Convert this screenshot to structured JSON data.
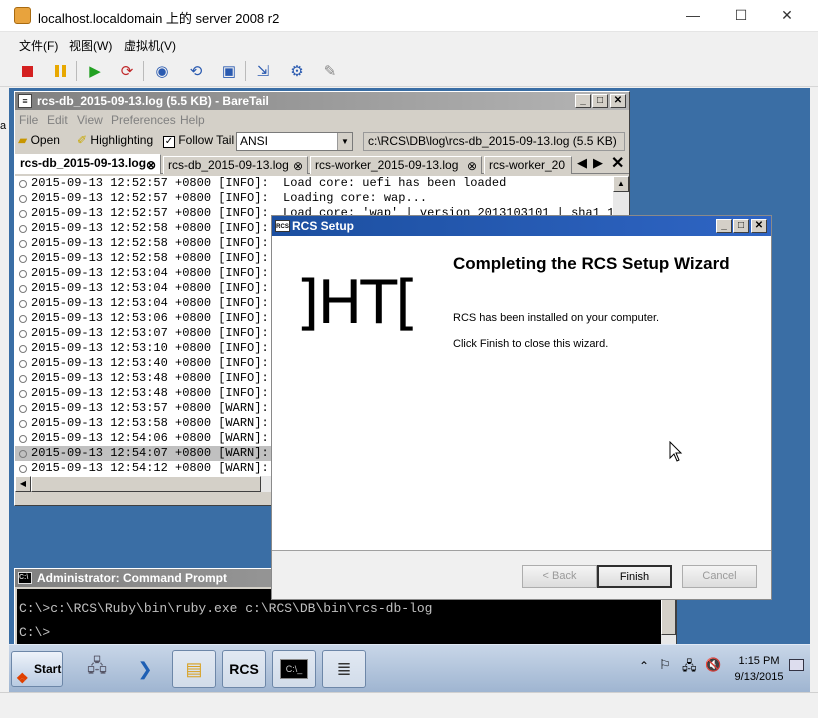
{
  "host": {
    "title": "localhost.localdomain 上的 server 2008 r2",
    "menu": [
      "文件(F)",
      "视图(W)",
      "虚拟机(V)"
    ],
    "controls": {
      "minimize": "—",
      "maximize": "☐",
      "close": "✕"
    }
  },
  "baretail": {
    "title": "rcs-db_2015-09-13.log (5.5 KB) - BareTail",
    "menu": [
      "File",
      "Edit",
      "View",
      "Preferences",
      "Help"
    ],
    "toolbar": {
      "open": "Open",
      "highlighting": "Highlighting",
      "follow_tail": "Follow Tail",
      "follow_tail_checked": "✓",
      "encoding": "ANSI",
      "path": "c:\\RCS\\DB\\log\\rcs-db_2015-09-13.log (5.5 KB)"
    },
    "tabs": [
      "rcs-db_2015-09-13.log",
      "rcs-db_2015-09-13.log",
      "rcs-worker_2015-09-13.log",
      "rcs-worker_20"
    ],
    "tab_close": "⊗",
    "log_lines": [
      "2015-09-13 12:52:57 +0800 [INFO]:  Load core: uefi has been loaded",
      "2015-09-13 12:52:57 +0800 [INFO]:  Loading core: wap...",
      "2015-09-13 12:52:57 +0800 [INFO]:  Load core: 'wap' | version 2013103101 | sha1 102",
      "2015-09-13 12:52:58 +0800 [INFO]:",
      "2015-09-13 12:52:58 +0800 [INFO]:",
      "2015-09-13 12:52:58 +0800 [INFO]:",
      "2015-09-13 12:53:04 +0800 [INFO]:",
      "2015-09-13 12:53:04 +0800 [INFO]:",
      "2015-09-13 12:53:04 +0800 [INFO]:",
      "2015-09-13 12:53:06 +0800 [INFO]:",
      "2015-09-13 12:53:07 +0800 [INFO]:",
      "2015-09-13 12:53:10 +0800 [INFO]:",
      "2015-09-13 12:53:40 +0800 [INFO]:",
      "2015-09-13 12:53:48 +0800 [INFO]:",
      "2015-09-13 12:53:48 +0800 [INFO]:",
      "2015-09-13 12:53:57 +0800 [WARN]:",
      "2015-09-13 12:53:58 +0800 [WARN]:",
      "2015-09-13 12:54:06 +0800 [WARN]:",
      "2015-09-13 12:54:07 +0800 [WARN]:",
      "2015-09-13 12:54:12 +0800 [WARN]:",
      "2015-09-13 12:54:12 +0800 [WARN]:"
    ],
    "selected_line": 18
  },
  "cmd": {
    "title": "Administrator: Command Prompt",
    "line1": "C:\\>c:\\RCS\\Ruby\\bin\\ruby.exe c:\\RCS\\DB\\bin\\rcs-db-log",
    "line2": "C:\\>"
  },
  "setup": {
    "title": "RCS Setup",
    "title_icon": "RCS",
    "logo_text": "]HT[",
    "heading": "Completing the RCS Setup Wizard",
    "line1": "RCS has been installed on your computer.",
    "line2": "Click Finish to close this wizard.",
    "back": "< Back",
    "finish": "Finish",
    "cancel": "Cancel"
  },
  "taskbar": {
    "start": "Start",
    "rcs_label": "RCS",
    "time": "1:15 PM",
    "date": "9/13/2015"
  },
  "colors": {
    "desktop": "#3a6ea5",
    "dialog_caption": "#1c4fa0",
    "stop": "#d42020",
    "pause": "#e8a800",
    "play": "#22a022"
  }
}
